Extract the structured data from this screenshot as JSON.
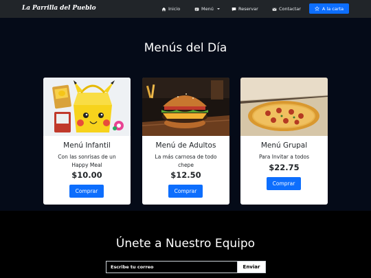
{
  "navbar": {
    "brand": "La Parrilla del Pueblo",
    "links": [
      {
        "label": "Inicio",
        "icon": "home-icon"
      },
      {
        "label": "Menú",
        "icon": "menu-card-icon"
      },
      {
        "label": "Reservar",
        "icon": "chat-icon"
      },
      {
        "label": "Contactar",
        "icon": "envelope-icon"
      }
    ],
    "cart_label": "A la carta",
    "cart_icon": "star-icon",
    "accent": "#0d6efd"
  },
  "menus": {
    "title": "Menús del Día",
    "cards": [
      {
        "title": "Menú Infantil",
        "text": "Con las sonrisas de un Happy Meal",
        "price": "$10.00",
        "button": "Comprar",
        "image": "happy-meal-box-image"
      },
      {
        "title": "Menú de Adultos",
        "text": "La más carnosa de todo chepe",
        "price": "$12.50",
        "button": "Comprar",
        "image": "burger-image"
      },
      {
        "title": "Menú Grupal",
        "text": "Para Invitar a todos",
        "price": "$22.75",
        "button": "Comprar",
        "image": "pizza-image"
      }
    ]
  },
  "join": {
    "title": "Únete a Nuestro Equipo",
    "email_placeholder": "Escribe tu correo",
    "send_label": "Enviar"
  }
}
